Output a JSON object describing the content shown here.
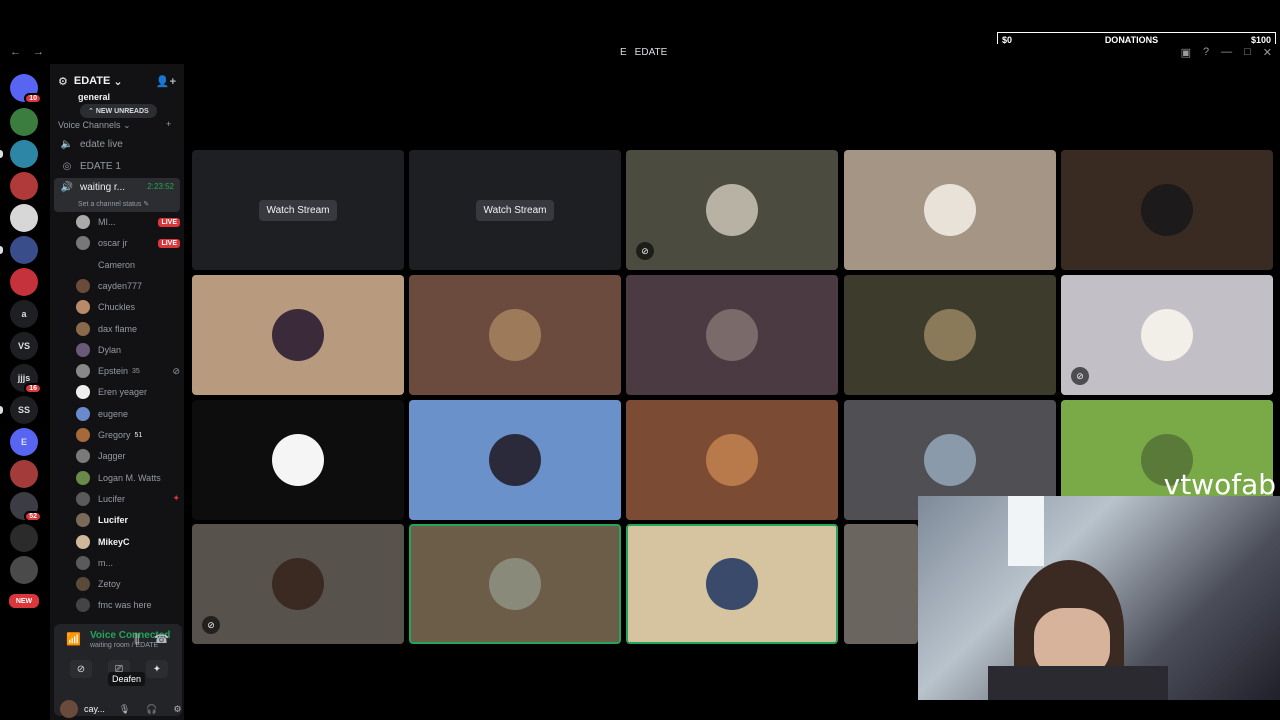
{
  "donation": {
    "left": "$0",
    "label": "DONATIONS",
    "right": "$100"
  },
  "window": {
    "title": "EDATE"
  },
  "server_rail": [
    {
      "name": "home",
      "label": "",
      "badge": "10",
      "color": "#5865f2"
    },
    {
      "name": "srv-2",
      "label": "",
      "badge": "",
      "color": "#3b7d3f"
    },
    {
      "name": "srv-3",
      "label": "",
      "badge": "",
      "color": "#2d86a6"
    },
    {
      "name": "srv-4",
      "label": "",
      "badge": "",
      "color": "#b03939"
    },
    {
      "name": "srv-5",
      "label": "",
      "badge": "",
      "color": "#d7d7d7"
    },
    {
      "name": "srv-6",
      "label": "",
      "badge": "",
      "color": "#394d8a"
    },
    {
      "name": "srv-7",
      "label": "",
      "badge": "",
      "color": "#c5323b"
    },
    {
      "name": "srv-a",
      "label": "a",
      "badge": "",
      "color": "#1e1f22"
    },
    {
      "name": "srv-vs",
      "label": "VS",
      "badge": "",
      "color": "#1e1f22"
    },
    {
      "name": "srv-jjs",
      "label": "jjjs",
      "badge": "16",
      "color": "#1e1f22"
    },
    {
      "name": "srv-ss",
      "label": "SS",
      "badge": "",
      "color": "#1e1f22"
    },
    {
      "name": "srv-e",
      "label": "E",
      "badge": "",
      "color": "#5865f2"
    },
    {
      "name": "srv-13",
      "label": "",
      "badge": "",
      "color": "#a33b3b"
    },
    {
      "name": "srv-14",
      "label": "",
      "badge": "52",
      "color": "#3c3c44"
    },
    {
      "name": "srv-15",
      "label": "",
      "badge": "",
      "color": "#2b2b2b"
    },
    {
      "name": "srv-16",
      "label": "",
      "badge": "",
      "color": "#4a4a4a"
    },
    {
      "name": "srv-new",
      "label": "NEW",
      "badge": "",
      "color": "#da373c"
    }
  ],
  "sidebar": {
    "guild_name": "EDATE",
    "category_top": "general",
    "new_unreads": "NEW UNREADS",
    "voice_category": "Voice Channels",
    "channels": [
      {
        "name": "edate live"
      },
      {
        "name": "EDATE 1"
      }
    ],
    "active_channel": {
      "name": "waiting r...",
      "timer": "2:23:52",
      "status": "Set a channel status"
    },
    "members": [
      {
        "name": "MI...",
        "live": "LIVE",
        "bright": false,
        "color": "#aaa"
      },
      {
        "name": "oscar jr",
        "live": "LIVE",
        "bright": false,
        "color": "#777"
      },
      {
        "name": "Cameron",
        "live": "",
        "bright": false,
        "color": "#121214"
      },
      {
        "name": "cayden777",
        "live": "",
        "bright": false,
        "color": "#6a4a3a"
      },
      {
        "name": "Chuckles",
        "live": "",
        "bright": false,
        "color": "#b88a6a"
      },
      {
        "name": "dax flame",
        "live": "",
        "bright": false,
        "color": "#8a6a4a"
      },
      {
        "name": "Dylan",
        "live": "",
        "bright": false,
        "color": "#6a5a7a"
      },
      {
        "name": "Epstein",
        "live": "",
        "bright": false,
        "color": "#888",
        "extra": "35"
      },
      {
        "name": "Eren yeager",
        "live": "",
        "bright": false,
        "color": "#eee"
      },
      {
        "name": "eugene",
        "live": "",
        "bright": false,
        "color": "#6a8acb"
      },
      {
        "name": "Gregory",
        "live": "",
        "bright": false,
        "color": "#a66a3a",
        "extra": "51"
      },
      {
        "name": "Jagger",
        "live": "",
        "bright": false,
        "color": "#7a7a7a"
      },
      {
        "name": "Logan M. Watts",
        "live": "",
        "bright": false,
        "color": "#6a8a4a"
      },
      {
        "name": "Lucifer",
        "live": "",
        "bright": false,
        "color": "#5a5a5a"
      },
      {
        "name": "Lucifer",
        "live": "",
        "bright": true,
        "color": "#7a6a5a"
      },
      {
        "name": "MikeyC",
        "live": "",
        "bright": true,
        "color": "#cfb89a"
      },
      {
        "name": "m...",
        "live": "",
        "bright": false,
        "color": "#5a5a5a"
      },
      {
        "name": "Zetoy",
        "live": "",
        "bright": false,
        "color": "#5a4a3a"
      },
      {
        "name": "fmc was here",
        "live": "",
        "bright": false,
        "color": "#444"
      }
    ],
    "voice": {
      "title": "Voice Connected",
      "subtitle": "waiting room / EDATE",
      "tooltip": "Deafen",
      "username": "cay..."
    }
  },
  "tiles": [
    {
      "kind": "stream",
      "label": "Watch Stream",
      "bg": "#1e1f22"
    },
    {
      "kind": "stream",
      "label": "Watch Stream",
      "bg": "#1e1f22"
    },
    {
      "kind": "avatar",
      "bg": "#4c4b40",
      "av": "#b8b2a4",
      "mute": true
    },
    {
      "kind": "avatar",
      "bg": "#a59585",
      "av": "#e8e2d8"
    },
    {
      "kind": "avatar",
      "bg": "#3a2b22",
      "av": "#1c1a1a"
    },
    {
      "kind": "avatar",
      "bg": "#b89a7e",
      "av": "#3a2a3a"
    },
    {
      "kind": "avatar",
      "bg": "#6c4b3f",
      "av": "#9c7a5a"
    },
    {
      "kind": "avatar",
      "bg": "#4c3a42",
      "av": "#7a6a6a"
    },
    {
      "kind": "avatar",
      "bg": "#3c3b2c",
      "av": "#8a7a5a"
    },
    {
      "kind": "avatar",
      "bg": "#c2c0c6",
      "av": "#f2efe9",
      "mute": true
    },
    {
      "kind": "avatar",
      "bg": "#0d0d0d",
      "av": "#f5f5f5"
    },
    {
      "kind": "avatar",
      "bg": "#6a91c9",
      "av": "#2a2a3a"
    },
    {
      "kind": "avatar",
      "bg": "#7c4b34",
      "av": "#b87a4a"
    },
    {
      "kind": "avatar",
      "bg": "#505054",
      "av": "#8a9aaa"
    },
    {
      "kind": "avatar",
      "bg": "#7aaa48",
      "av": "#5a7a3a"
    },
    {
      "kind": "avatar",
      "bg": "#57524c",
      "av": "#3a2a22",
      "mute": true
    },
    {
      "kind": "avatar",
      "bg": "#6c5d48",
      "av": "#8a8a7a",
      "speaking": true
    },
    {
      "kind": "avatar",
      "bg": "#d6c3a0",
      "av": "#3a4a6a",
      "speaking": true
    },
    {
      "kind": "avatar",
      "bg": "#6a655e",
      "av": "#6a655e"
    }
  ],
  "webcam": {
    "tag": "vtwofab"
  }
}
